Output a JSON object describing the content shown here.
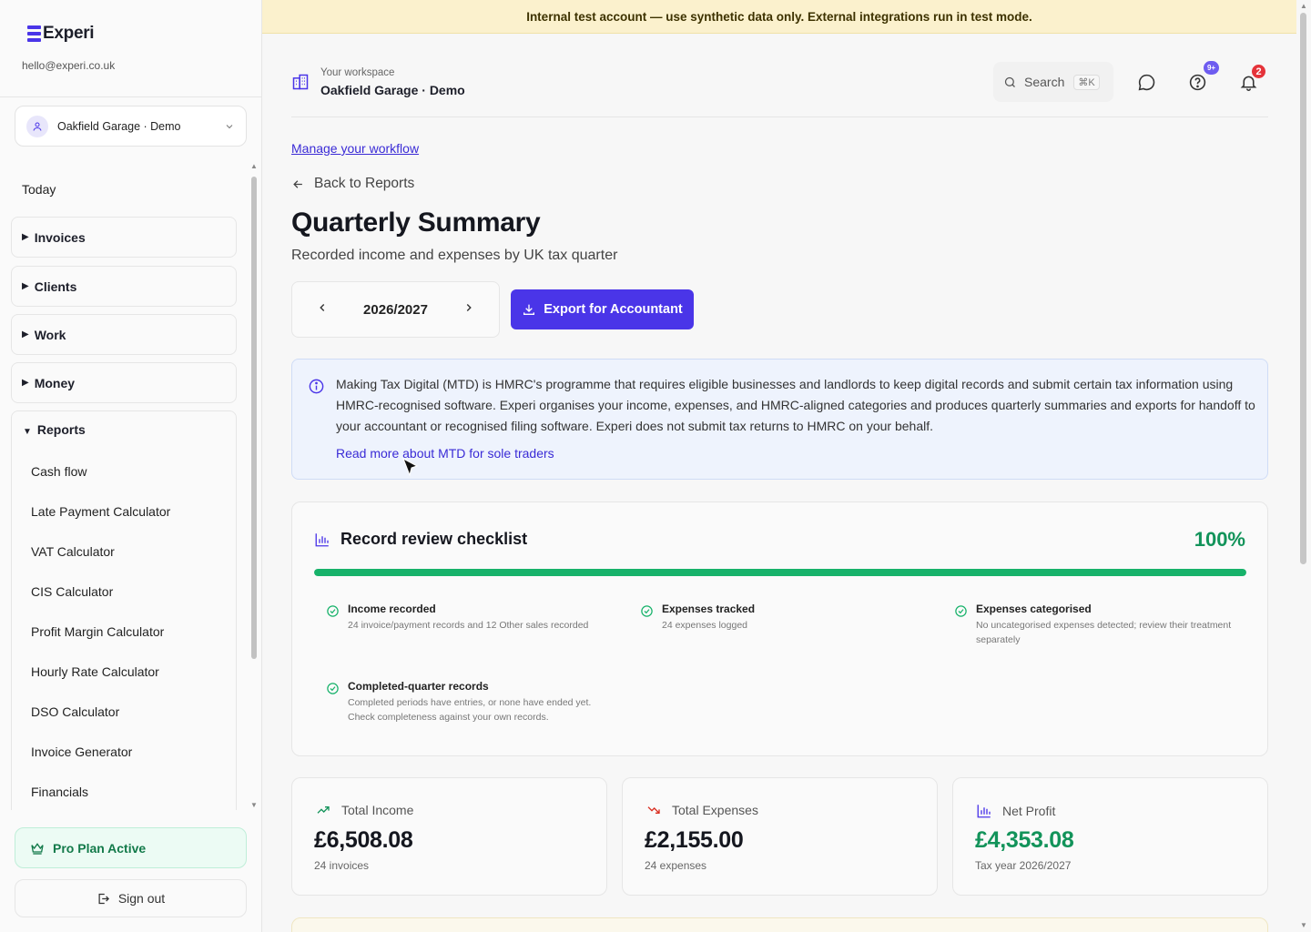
{
  "sidebar": {
    "brand": "Experi",
    "email": "hello@experi.co.uk",
    "workspace_selector": "Oakfield Garage · Demo",
    "today_label": "Today",
    "groups": [
      {
        "label": "Invoices"
      },
      {
        "label": "Clients"
      },
      {
        "label": "Work"
      },
      {
        "label": "Money"
      }
    ],
    "reports": {
      "label": "Reports",
      "items": [
        "Cash flow",
        "Late Payment Calculator",
        "VAT Calculator",
        "CIS Calculator",
        "Profit Margin Calculator",
        "Hourly Rate Calculator",
        "DSO Calculator",
        "Invoice Generator",
        "Financials"
      ]
    },
    "plan_label": "Pro Plan Active",
    "signout_label": "Sign out"
  },
  "banner": "Internal test account — use synthetic data only. External integrations run in test mode.",
  "header": {
    "workspace_label": "Your workspace",
    "workspace_name": "Oakfield Garage · Demo",
    "search_label": "Search",
    "search_shortcut": "⌘K",
    "help_badge": "9+",
    "notifications_badge": "2"
  },
  "page": {
    "manage_link": "Manage your workflow",
    "back_label": "Back to Reports",
    "title": "Quarterly Summary",
    "subtitle": "Recorded income and expenses by UK tax quarter",
    "year": "2026/2027",
    "export_label": "Export for Accountant"
  },
  "info": {
    "text": "Making Tax Digital (MTD) is HMRC's programme that requires eligible businesses and landlords to keep digital records and submit certain tax information using HMRC-recognised software. Experi organises your income, expenses, and HMRC-aligned categories and produces quarterly summaries and exports for handoff to your accountant or recognised filing software. Experi does not submit tax returns to HMRC on your behalf.",
    "link": "Read more about MTD for sole traders"
  },
  "checklist": {
    "title": "Record review checklist",
    "percent_label": "100%",
    "progress": 1.0,
    "items": [
      {
        "title": "Income recorded",
        "desc": "24 invoice/payment records and 12 Other sales recorded"
      },
      {
        "title": "Expenses tracked",
        "desc": "24 expenses logged"
      },
      {
        "title": "Expenses categorised",
        "desc": "No uncategorised expenses detected; review their treatment separately"
      },
      {
        "title": "Completed-quarter records",
        "desc": "Completed periods have entries, or none have ended yet. Check completeness against your own records."
      }
    ]
  },
  "stats": [
    {
      "label": "Total Income",
      "value": "£6,508.08",
      "sub": "24 invoices",
      "icon": "trending-up-icon",
      "color": "#12935a"
    },
    {
      "label": "Total Expenses",
      "value": "£2,155.00",
      "sub": "24 expenses",
      "icon": "trending-down-icon",
      "color": "#d92d20"
    },
    {
      "label": "Net Profit",
      "value": "£4,353.08",
      "sub": "Tax year 2026/2027",
      "icon": "bar-chart-icon",
      "color": "#12935a"
    }
  ],
  "colors": {
    "accent": "#4a35e8",
    "success": "#17b26a",
    "banner_bg": "#fbf1cd",
    "info_bg": "#eef3fd",
    "danger": "#d92d20"
  }
}
